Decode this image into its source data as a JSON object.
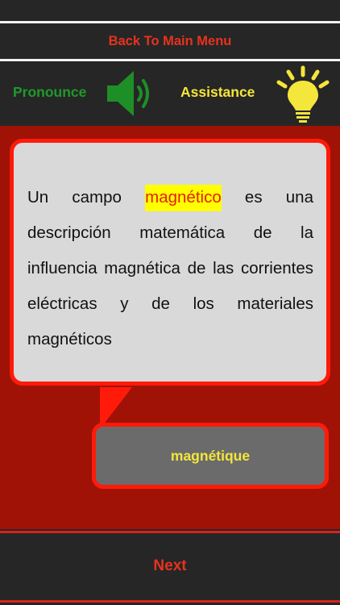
{
  "header": {
    "back_label": "Back To Main Menu"
  },
  "toolbar": {
    "pronounce_label": "Pronounce",
    "assistance_label": "Assistance",
    "pronounce_icon": "speaker-icon",
    "assistance_icon": "lightbulb-icon"
  },
  "question": {
    "before": "Un campo ",
    "highlight": "magnético",
    "after": " es una descripción matemática de la influencia magnética de las corrientes eléctricas y de los materiales magnéticos"
  },
  "answer": {
    "text": "magnétique"
  },
  "footer": {
    "next_label": "Next"
  },
  "colors": {
    "accent_red": "#ff1a0a",
    "pronounce_green": "#1f9a2a",
    "assist_yellow": "#f4e63a",
    "stage_red": "#a01206",
    "highlight_yellow": "#ffff00"
  }
}
